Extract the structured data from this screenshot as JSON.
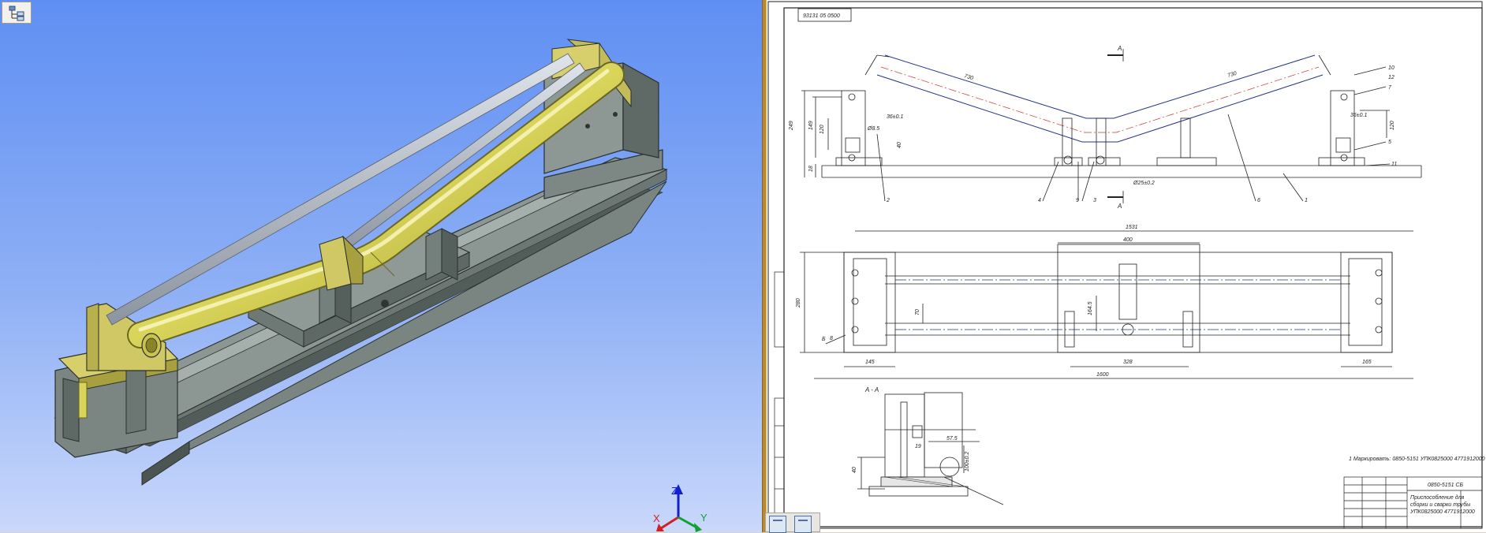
{
  "viewport": {
    "axes": {
      "x_label": "X",
      "y_label": "Y",
      "z_label": "Z"
    },
    "colors": {
      "pipe": "#d9d45a",
      "pipe_dark": "#9f9a2e",
      "rod": "#a5acb7",
      "frame": "#7b8682",
      "frame_dark": "#4f5955",
      "bracket": "#c3bc5c"
    }
  },
  "sheet": {
    "stamp_code": "93131 05 0500",
    "section_label_top": "A",
    "section_label_bottom": "A",
    "section_view_title": "A - A",
    "note_text": "1 Маркировать: 0850-5151 УПК0825000 4771912000",
    "titleblock_code": "0850-5151 СБ",
    "titleblock_name_1": "Приспособление для",
    "titleblock_name_2": "сборки и сварки трубы",
    "titleblock_name_3": "УПК0825000 4771912000",
    "front_dims": {
      "h_total": "249",
      "h_mid": "149",
      "h_low": "120",
      "h_base": "18",
      "h_right": "120",
      "len_left": "730",
      "len_right": "730",
      "ang_left": "36±0.1",
      "ang_right": "36±0.1",
      "hole": "Ø8.5",
      "center": "Ø25±0.2",
      "small": "40"
    },
    "plan_dims": {
      "top": "1531",
      "center": "400",
      "height": "280",
      "side_1": "70",
      "side_2": "164.5",
      "left": "145",
      "mid": "328",
      "right": "165",
      "total": "1600",
      "b": "Б"
    },
    "section_dims": {
      "d1": "57.5",
      "d2": "19",
      "d3": "40",
      "d4": "100±0.2"
    },
    "callouts": [
      "10",
      "12",
      "7",
      "5",
      "11",
      "2",
      "4",
      "9",
      "3",
      "6",
      "1",
      "8"
    ]
  }
}
